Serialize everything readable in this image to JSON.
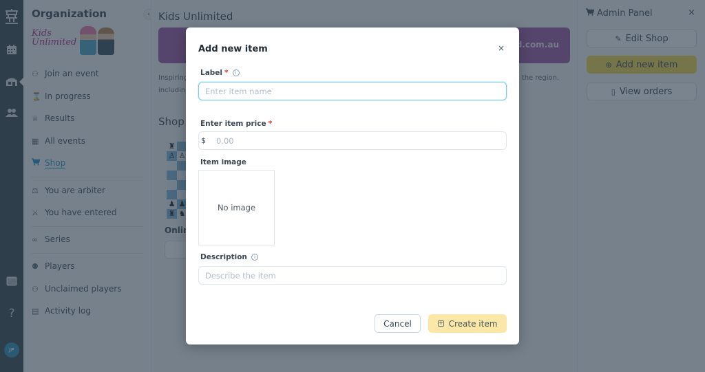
{
  "rail": {
    "icons": [
      "logo-tower-icon",
      "calendar-icon",
      "organization-icon",
      "people-icon",
      "window-icon",
      "help-icon"
    ],
    "help_glyph": "?",
    "avatar_initials": "JP"
  },
  "sidebar": {
    "title": "Organization",
    "logo_text_line1": "Kids",
    "logo_text_line2": "Unlimited",
    "collapse_glyph": "‹",
    "groups": [
      [
        {
          "label": "Join an event",
          "icon": "user-plus-icon",
          "glyph": "⚇"
        },
        {
          "label": "In progress",
          "icon": "hourglass-icon",
          "glyph": "⌛"
        },
        {
          "label": "Results",
          "icon": "trophy-icon",
          "glyph": "♕"
        },
        {
          "label": "All events",
          "icon": "calendar-icon",
          "glyph": "▦"
        },
        {
          "label": "Shop",
          "icon": "cart-icon",
          "glyph": "🛒",
          "active": true
        }
      ],
      [
        {
          "label": "You are arbiter",
          "icon": "scales-icon",
          "glyph": "⚖"
        },
        {
          "label": "You have entered",
          "icon": "crossed-swords-icon",
          "glyph": "⚔"
        }
      ],
      [
        {
          "label": "Series",
          "icon": "link-icon",
          "glyph": "∞"
        }
      ],
      [
        {
          "label": "Players",
          "icon": "players-icon",
          "glyph": "⚉"
        },
        {
          "label": "Unclaimed players",
          "icon": "unclaimed-players-icon",
          "glyph": "⚇"
        },
        {
          "label": "Activity log",
          "icon": "clipboard-icon",
          "glyph": "▤"
        }
      ]
    ]
  },
  "main": {
    "title": "Kids Unlimited",
    "banner_text": "kidsunlimited.com.au",
    "intro": "Inspiring children through chess. Kids Unlimited has been running chess events for young players across the region, including junior Championships which are open to all.",
    "shop_heading": "Shop",
    "product_name": "Online chess lesson"
  },
  "admin": {
    "title": "Admin Panel",
    "close_glyph": "×",
    "buttons": [
      {
        "label": "Edit Shop",
        "icon": "edit-icon",
        "glyph": "✎"
      },
      {
        "label": "Add new item",
        "icon": "plus-circle-icon",
        "glyph": "⊕"
      },
      {
        "label": "View orders",
        "icon": "receipt-icon",
        "glyph": "▯"
      }
    ]
  },
  "modal": {
    "title": "Add new item",
    "close_glyph": "×",
    "label_field": {
      "label": "Label",
      "required_mark": "*",
      "placeholder": "Enter item name",
      "value": ""
    },
    "price_field": {
      "label": "Enter item price",
      "required_mark": "*",
      "prefix": "$",
      "placeholder": "0.00",
      "value": ""
    },
    "image_field": {
      "label": "Item image",
      "empty_text": "No image"
    },
    "description_field": {
      "label": "Description",
      "placeholder": "Describe the item",
      "value": ""
    },
    "info_glyph": "i",
    "cancel_label": "Cancel",
    "create_label": "Create item",
    "create_glyph": "+"
  },
  "colors": {
    "accent": "#1f8fc7",
    "primary_button": "#f5d44a",
    "create_button": "#fbe8a6",
    "banner": "#9e5aa5",
    "rail": "#37474f",
    "required": "#e03a3a"
  }
}
